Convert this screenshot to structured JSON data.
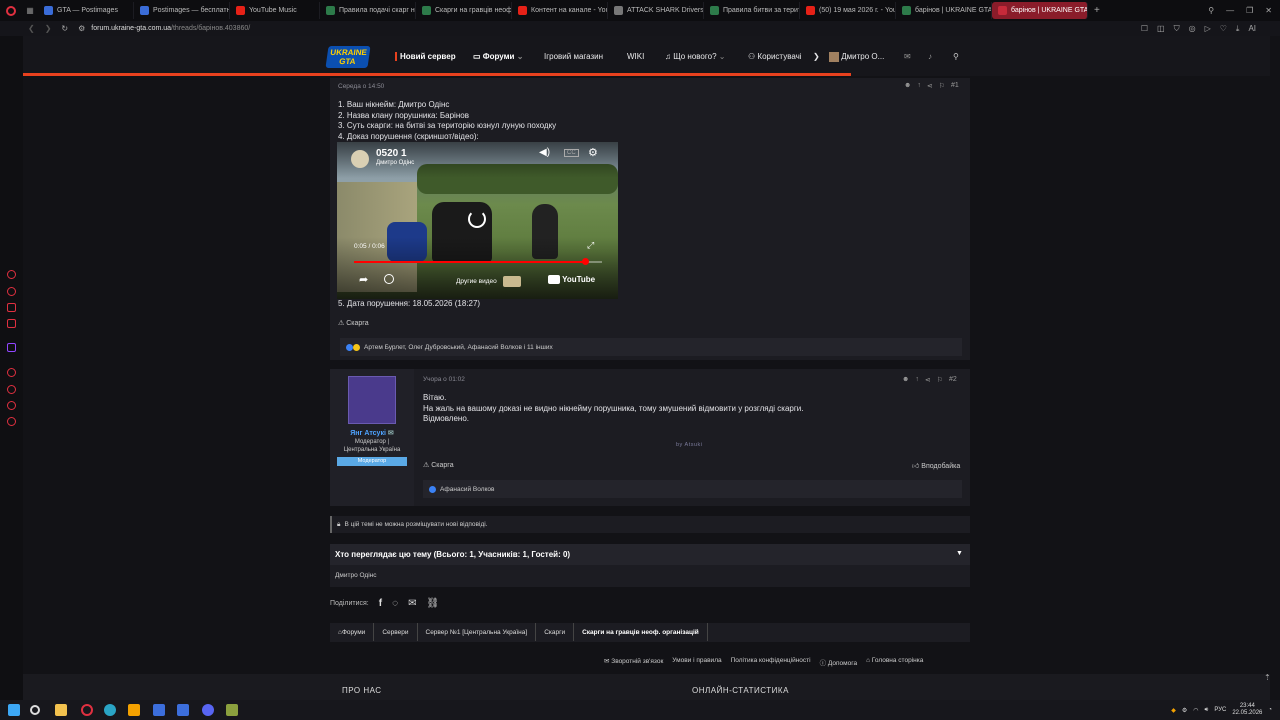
{
  "browser": {
    "tabs": [
      {
        "label": "GTA — Postimages",
        "color": "#3a6cd8"
      },
      {
        "label": "Postimages — бесплатны",
        "color": "#3a6cd8"
      },
      {
        "label": "YouTube Music",
        "color": "#e62117"
      },
      {
        "label": "Правила подачі скарг на",
        "color": "#2d7b4a"
      },
      {
        "label": "Скарги на гравців неоф.",
        "color": "#2d7b4a"
      },
      {
        "label": "Контент на канале - YouT",
        "color": "#e62117"
      },
      {
        "label": "ATTACK SHARK Drivers, I",
        "color": "#777"
      },
      {
        "label": "Правила битви за терито",
        "color": "#2d7b4a"
      },
      {
        "label": "(50) 19 мая 2026 г. - YouT",
        "color": "#e62117"
      },
      {
        "label": "барінов | UKRAINE GTA",
        "color": "#2d7b4a"
      },
      {
        "label": "барінов | UKRAINE GTA -",
        "color": "#c62a3a",
        "active": true
      }
    ],
    "new_tab": "+",
    "url_host": "forum.ukraine-gta.com.ua",
    "url_path": "/threads/барінов.403860/",
    "ai_label": "AI"
  },
  "header": {
    "logo_line1": "UKRAINE",
    "logo_line2": "GTA",
    "nav_new_server": "Новий сервер",
    "nav_forums": "Форуми",
    "nav_shop": "Ігровий магазин",
    "nav_wiki": "WIKI",
    "nav_whats_new": "Що нового?",
    "nav_users": "Користувачі",
    "nav_user": "Дмитро О..."
  },
  "post1": {
    "time": "Середа о 14:50",
    "num": "#1",
    "lines": [
      "1. Ваш нікнейм: Дмитро Одінс",
      "2. Назва клану порушника: Барінов",
      "3. Суть скарги: на битві за територію юзнул луную походку",
      "4. Доказ порушення (скриншот/відео):"
    ],
    "line5": "5. Дата порушення: 18.05.2026 (18:27)",
    "report": "Скарга",
    "reactions": "Артем Бурлет, Олег Дубровський, Афанасий Волков і 11 інших"
  },
  "video": {
    "title": "0520 1",
    "channel": "Дмитро Одінс",
    "time": "0:05 / 0:06",
    "progress": 0.93,
    "other_videos": "Другие видео",
    "yt_label": "YouTube",
    "cc": "CC"
  },
  "post2": {
    "username": "Янг Атсукі",
    "role": "Модератор |",
    "role2": "Центральна Україна",
    "badge": "Модератор",
    "time": "Учора о 01:02",
    "num": "#2",
    "lines": [
      "Вітаю.",
      "На жаль на вашому доказі не видно нікнейму порушника, тому змушений відмовити у розгляді скарги.",
      "Відмовлено."
    ],
    "signature": "by Atsuki",
    "report": "Скарга",
    "like": "Вподобайка",
    "reactions": "Афанасий Волков"
  },
  "locked_notice": "В цій темі не можна розміщувати нові відповіді.",
  "viewers": {
    "title": "Хто переглядає цю тему (Всього: 1, Учасників: 1, Гостей: 0)",
    "names": "Дмитро Одінс"
  },
  "share_label": "Поділитися:",
  "breadcrumb": [
    "Форуми",
    "Сервери",
    "Сервер №1 [Центральна Україна]",
    "Скарги",
    "Скарги на гравців неоф. організацій"
  ],
  "footer_links": [
    "Зворотній зв'язок",
    "Умови і правила",
    "Політика конфіденційності",
    "Допомога",
    "Головна сторінка"
  ],
  "footer_about": "ПРО НАС",
  "footer_stats": "ОНЛАЙН-СТАТИСТИКА",
  "tray": {
    "lang": "РУС",
    "time": "23:44",
    "date": "22.05.2026"
  },
  "colors": {
    "accent": "#e8411e",
    "badge": "#5aa9e6",
    "username": "#4ea3ff",
    "opera": "#e03040"
  }
}
